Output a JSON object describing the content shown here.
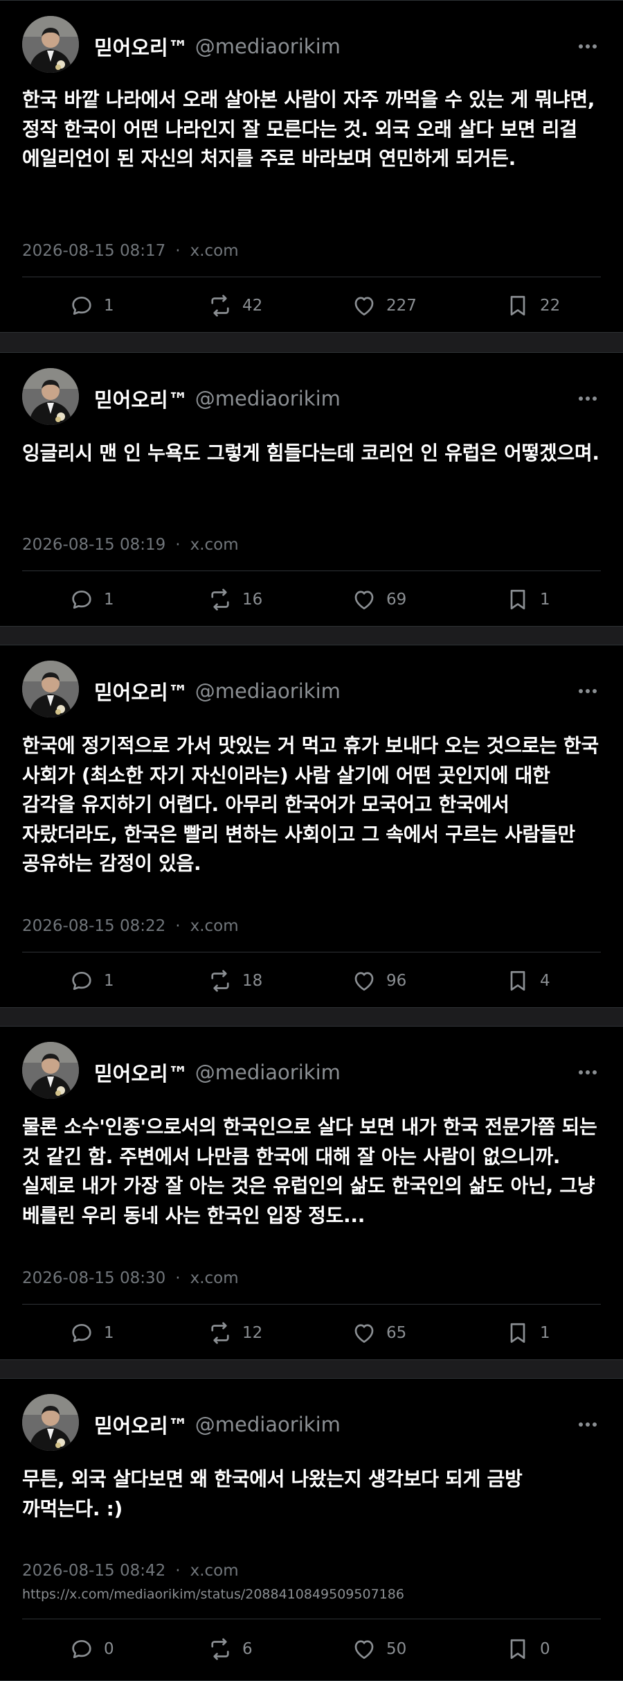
{
  "colors": {
    "background": "#000000",
    "page_gap": "#1c1c1e",
    "text": "#ffffff",
    "muted": "#71767b",
    "divider": "#2f3336"
  },
  "icons": {
    "reply": "speech-bubble-icon",
    "retweet": "retweet-arrows-icon",
    "like": "heart-icon",
    "bookmark": "bookmark-icon",
    "more": "more-dots-icon"
  },
  "posts": [
    {
      "display_name": "믿어오리™",
      "handle": "@mediaorikim",
      "text": "한국 바깥 나라에서 오래 살아본 사람이 자주 까먹을 수 있는 게 뭐냐면, 정작 한국이 어떤 나라인지 잘 모른다는 것. 외국 오래 살다 보면 리걸 에일리언이 된 자신의 처지를 주로 바라보며 연민하게 되거든.",
      "timestamp": "2026-08-15 08:17",
      "source": "x.com",
      "link": "",
      "replies": "1",
      "retweets": "42",
      "likes": "227",
      "bookmarks": "22"
    },
    {
      "display_name": "믿어오리™",
      "handle": "@mediaorikim",
      "text": "잉글리시 맨 인 누욕도 그렇게 힘들다는데 코리언 인 유럽은 어떻겠으며.",
      "timestamp": "2026-08-15 08:19",
      "source": "x.com",
      "link": "",
      "replies": "1",
      "retweets": "16",
      "likes": "69",
      "bookmarks": "1"
    },
    {
      "display_name": "믿어오리™",
      "handle": "@mediaorikim",
      "text": "한국에 정기적으로 가서 맛있는 거 먹고 휴가 보내다 오는 것으로는 한국 사회가 (최소한 자기 자신이라는) 사람 살기에 어떤 곳인지에 대한 감각을 유지하기 어렵다. 아무리 한국어가 모국어고 한국에서 자랐더라도, 한국은 빨리 변하는 사회이고 그 속에서 구르는 사람들만 공유하는 감정이 있음.",
      "timestamp": "2026-08-15 08:22",
      "source": "x.com",
      "link": "",
      "replies": "1",
      "retweets": "18",
      "likes": "96",
      "bookmarks": "4"
    },
    {
      "display_name": "믿어오리™",
      "handle": "@mediaorikim",
      "text": "물론 소수'인종'으로서의 한국인으로 살다 보면 내가 한국 전문가쯤 되는 것 같긴 함. 주변에서 나만큼 한국에 대해 잘 아는 사람이 없으니까. 실제로 내가 가장 잘 아는 것은 유럽인의 삶도 한국인의 삶도 아닌, 그냥 베를린 우리 동네 사는 한국인 입장 정도...",
      "timestamp": "2026-08-15 08:30",
      "source": "x.com",
      "link": "",
      "replies": "1",
      "retweets": "12",
      "likes": "65",
      "bookmarks": "1"
    },
    {
      "display_name": "믿어오리™",
      "handle": "@mediaorikim",
      "text": "무튼, 외국 살다보면 왜 한국에서 나왔는지 생각보다 되게 금방 까먹는다. :)",
      "timestamp": "2026-08-15 08:42",
      "source": "x.com",
      "link": "https://x.com/mediaorikim/status/2088410849509507186",
      "replies": "0",
      "retweets": "6",
      "likes": "50",
      "bookmarks": "0"
    }
  ]
}
